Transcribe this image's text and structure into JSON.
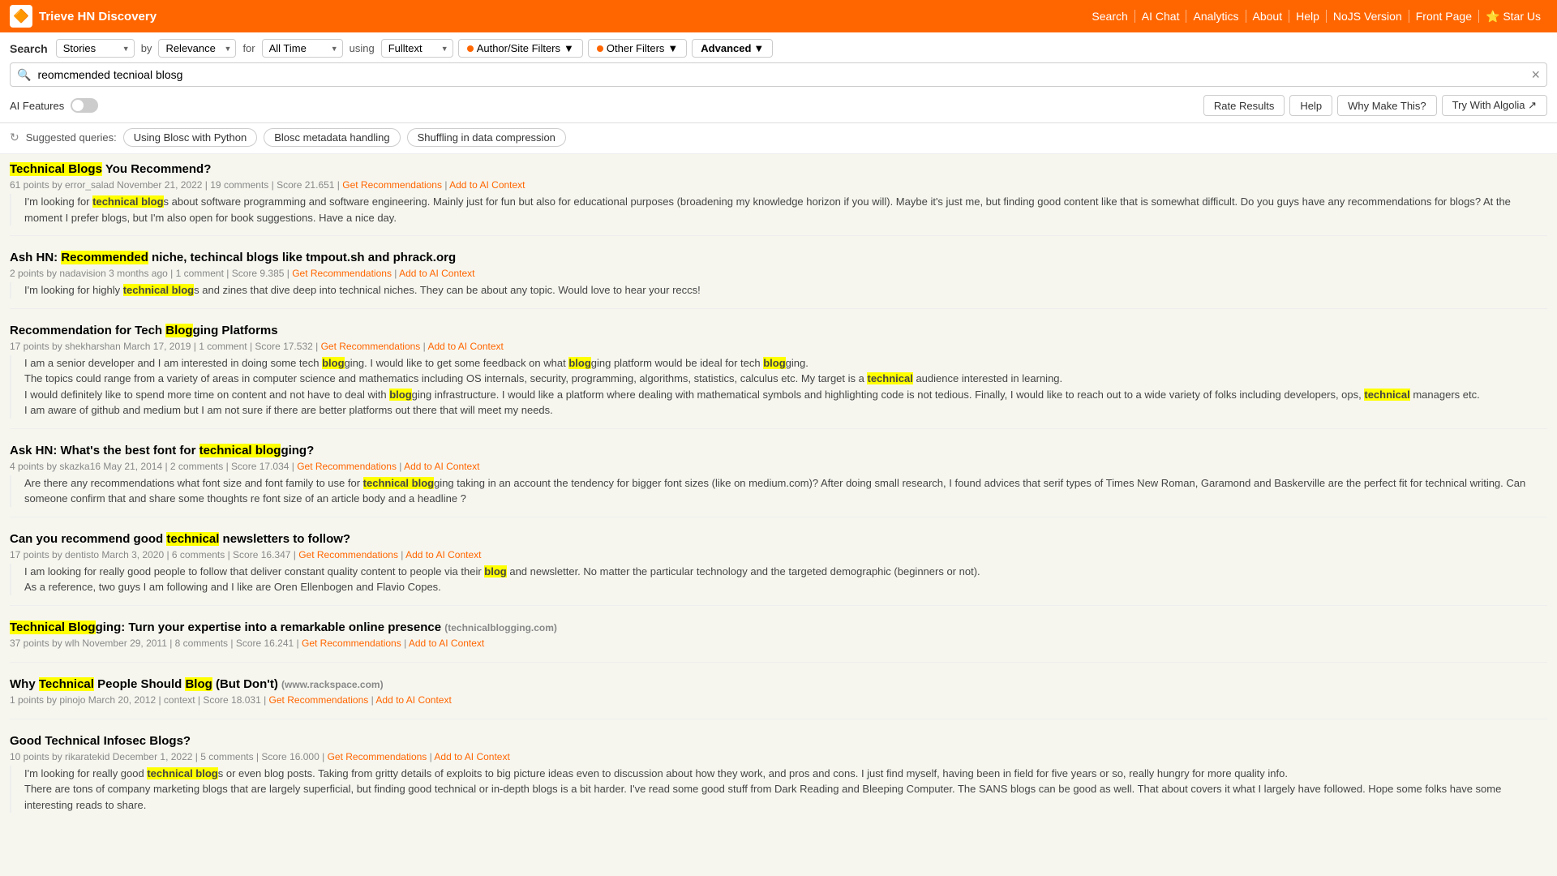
{
  "header": {
    "logo_icon": "🔶",
    "logo_text": "Trieve HN Discovery",
    "nav_links": [
      {
        "label": "Search",
        "href": "#"
      },
      {
        "label": "AI Chat",
        "href": "#"
      },
      {
        "label": "Analytics",
        "href": "#"
      },
      {
        "label": "About",
        "href": "#"
      },
      {
        "label": "Help",
        "href": "#"
      },
      {
        "label": "NoJS Version",
        "href": "#"
      },
      {
        "label": "Front Page",
        "href": "#"
      },
      {
        "label": "⭐ Star Us",
        "href": "#"
      }
    ]
  },
  "search_controls": {
    "label": "Search",
    "type_label": "Stories",
    "by_label": "by",
    "sort_label": "Relevance",
    "for_label": "for",
    "time_label": "All Time",
    "using_label": "using",
    "search_type_label": "Fulltext",
    "author_filter_label": "Author/Site Filters",
    "other_filter_label": "Other Filters",
    "advanced_label": "Advanced"
  },
  "search_input": {
    "value": "reomcmended tecniοal blosg",
    "placeholder": ""
  },
  "ai_features": {
    "label": "AI Features"
  },
  "action_buttons": {
    "rate": "Rate Results",
    "help": "Help",
    "why": "Why Make This?",
    "algolia": "Try With Algolia ↗"
  },
  "suggested": {
    "label": "Suggested queries:",
    "chips": [
      "Using Blosc with Python",
      "Blosc metadata handling",
      "Shuffling in data compression"
    ]
  },
  "results": [
    {
      "id": "r1",
      "title_parts": [
        {
          "text": "Technical Blogs",
          "hl": "yellow"
        },
        {
          "text": " You Recommend?",
          "hl": "none"
        }
      ],
      "title_text": "Technical Blogs You Recommend?",
      "meta": "61 points by error_salad November 21, 2022 | 19 comments | Score 21.651 | Get Recommendations | Add to AI Context",
      "body": "I'm looking for <span class=\"hl-yellow\">technical blog</span>s about software programming and software engineering. Mainly just for fun but also for educational purposes (broadening my knowledge horizon if you will). Maybe it's just me, but finding good content like that is somewhat difficult. Do you guys have any recommendations for blogs? At the moment I prefer blogs, but I'm also open for book suggestions. Have a nice day."
    },
    {
      "id": "r2",
      "title_parts": [
        {
          "text": "Ash HN: ",
          "hl": "none"
        },
        {
          "text": "Recommended",
          "hl": "yellow"
        },
        {
          "text": " niche, techincal blogs like tmpout.sh and phrack.org",
          "hl": "none"
        }
      ],
      "title_text": "Ash HN: Recommended niche, techincal blogs like tmpout.sh and phrack.org",
      "meta": "2 points by nadavision 3 months ago | 1 comment | Score 9.385 | Get Recommendations | Add to AI Context",
      "body": "I'm looking for highly <span class=\"hl-yellow\">technical blog</span>s and zines that dive deep into technical niches. They can be about any topic. Would love to hear your reccs!"
    },
    {
      "id": "r3",
      "title_parts": [
        {
          "text": "Recommendation for Tech ",
          "hl": "none"
        },
        {
          "text": "Blog",
          "hl": "yellow"
        },
        {
          "text": "ging Platforms",
          "hl": "none"
        }
      ],
      "title_text": "Recommendation for Tech Blogging Platforms",
      "meta": "17 points by shekharshan March 17, 2019 | 1 comment | Score 17.532 | Get Recommendations | Add to AI Context",
      "body_paragraphs": [
        "I am a senior developer and I am interested in doing some tech <span class=\"hl-yellow\">blog</span>ging. I would like to get some feedback on what <span class=\"hl-yellow\">blog</span>ging platform would be ideal for tech <span class=\"hl-yellow\">blog</span>ging.",
        "The topics could range from a variety of areas in computer science and mathematics including OS internals, security, programming, algorithms, statistics, calculus etc. My target is a <span class=\"hl-yellow\">technical</span> audience interested in learning.",
        "I would definitely like to spend more time on content and not have to deal with <span class=\"hl-yellow\">blog</span>ging infrastructure. I would like a platform where dealing with mathematical symbols and highlighting code is not tedious. Finally, I would like to reach out to a wide variety of folks including developers, ops, <span class=\"hl-yellow\">technical</span> managers etc.",
        "I am aware of github and medium but I am not sure if there are better platforms out there that will meet my needs."
      ]
    },
    {
      "id": "r4",
      "title_parts": [
        {
          "text": "Ask HN: What's the best font for ",
          "hl": "none"
        },
        {
          "text": "technical blog",
          "hl": "yellow"
        },
        {
          "text": "ging?",
          "hl": "none"
        }
      ],
      "title_text": "Ask HN: What's the best font for technical blogging?",
      "meta": "4 points by skazka16 May 21, 2014 | 2 comments | Score 17.034 | Get Recommendations | Add to AI Context",
      "body": "Are there any recommendations what font size and font family to use for <span class=\"hl-yellow\">technical blog</span>ging taking in an account the tendency for bigger font sizes (like on medium.com)? After doing small research, I found advices that serif types of Times New Roman, Garamond and Baskerville are the perfect fit for technical writing. Can someone confirm that and share some thoughts re font size of an article body and a headline ?"
    },
    {
      "id": "r5",
      "title_parts": [
        {
          "text": "Can you recommend good ",
          "hl": "none"
        },
        {
          "text": "technical",
          "hl": "yellow"
        },
        {
          "text": " newsletters to follow?",
          "hl": "none"
        }
      ],
      "title_text": "Can you recommend good technical newsletters to follow?",
      "meta": "17 points by dentisto March 3, 2020 | 6 comments | Score 16.347 | Get Recommendations | Add to AI Context",
      "body_paragraphs": [
        "I am looking for really good people to follow that deliver constant quality content to people via their <span class=\"hl-yellow\">blog</span> and newsletter. No matter the particular technology and the targeted demographic (beginners or not).",
        "As a reference, two guys I am following and I like are Oren Ellenbogen and Flavio Copes."
      ]
    },
    {
      "id": "r6",
      "title_parts": [
        {
          "text": "Technical Blog",
          "hl": "yellow"
        },
        {
          "text": "ging: Turn your expertise into a remarkable online presence",
          "hl": "none"
        },
        {
          "text": " (technicalblogging.com)",
          "hl": "url"
        }
      ],
      "title_text": "Technical Blogging: Turn your expertise into a remarkable online presence (technicalblogging.com)",
      "meta": "37 points by wlh November 29, 2011 | 8 comments | Score 16.241 | Get Recommendations | Add to AI Context",
      "body": ""
    },
    {
      "id": "r7",
      "title_parts": [
        {
          "text": "Why ",
          "hl": "none"
        },
        {
          "text": "Technical",
          "hl": "yellow"
        },
        {
          "text": " People Should ",
          "hl": "none"
        },
        {
          "text": "Blog",
          "hl": "yellow"
        },
        {
          "text": " (But Don't)",
          "hl": "none"
        },
        {
          "text": " (www.rackspace.com)",
          "hl": "url"
        }
      ],
      "title_text": "Why Technical People Should Blog (But Don't) (www.rackspace.com)",
      "meta": "1 points by pinojo March 20, 2012 | context | Score 18.031 | Get Recommendations | Add to AI Context",
      "body": ""
    },
    {
      "id": "r8",
      "title_parts": [
        {
          "text": "Good Technical Infosec Blogs?",
          "hl": "none"
        }
      ],
      "title_text": "Good Technical Infosec Blogs?",
      "meta": "10 points by rikaratekid December 1, 2022 | 5 comments | Score 16.000 | Get Recommendations | Add to AI Context",
      "body_paragraphs": [
        "I'm looking for really good <span class=\"hl-yellow\">technical blog</span>s or even blog posts. Starting from gritty details of exploits to big picture ideas even to discussion about how they work, and pros and cons. I just find myself, having been in field for five years or so, really hungry for more quality info.",
        "There are tons of company marketing blogs that are largely superficial, but finding good technical or in-depth blogs is a bit harder. I've read some good stuff from Dark Reading and Bleeping Computer. The SANS blogs can be good as well. That about covers it what I largely have followed. Hope some folks have some interesting reads to share."
      ]
    }
  ]
}
